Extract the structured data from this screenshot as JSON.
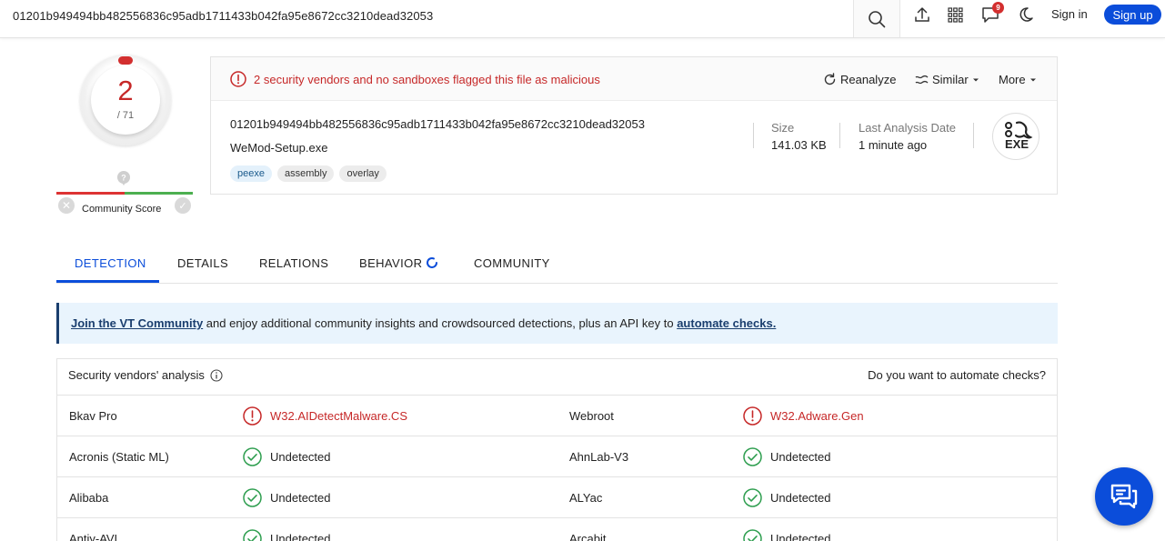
{
  "header": {
    "search_value": "01201b949494bb482556836c95adb1711433b042fa95e8672cc3210dead32053",
    "notification_count": "9",
    "signin_label": "Sign in",
    "signup_label": "Sign up",
    "accent_color": "#0b4dda"
  },
  "score": {
    "detections": "2",
    "total": "/ 71",
    "community_label": "Community Score",
    "community_q": "?"
  },
  "file": {
    "alert_text": "2 security vendors and no sandboxes flagged this file as malicious",
    "reanalyze_label": "Reanalyze",
    "similar_label": "Similar",
    "more_label": "More",
    "hash": "01201b949494bb482556836c95adb1711433b042fa95e8672cc3210dead32053",
    "name": "WeMod-Setup.exe",
    "tags": [
      "peexe",
      "assembly",
      "overlay"
    ],
    "size_label": "Size",
    "size_value": "141.03 KB",
    "date_label": "Last Analysis Date",
    "date_value": "1 minute ago",
    "type_label": "EXE"
  },
  "tabs": [
    "DETECTION",
    "DETAILS",
    "RELATIONS",
    "BEHAVIOR",
    "COMMUNITY"
  ],
  "banner": {
    "link1": "Join the VT Community",
    "middle": " and enjoy additional community insights and crowdsourced detections, plus an API key to ",
    "link2": "automate checks."
  },
  "vendors": {
    "title": "Security vendors' analysis",
    "automate_question": "Do you want to automate checks?",
    "rows": [
      {
        "left_name": "Bkav Pro",
        "left_result": "W32.AIDetectMalware.CS",
        "left_status": "malicious",
        "right_name": "Webroot",
        "right_result": "W32.Adware.Gen",
        "right_status": "malicious"
      },
      {
        "left_name": "Acronis (Static ML)",
        "left_result": "Undetected",
        "left_status": "undetected",
        "right_name": "AhnLab-V3",
        "right_result": "Undetected",
        "right_status": "undetected"
      },
      {
        "left_name": "Alibaba",
        "left_result": "Undetected",
        "left_status": "undetected",
        "right_name": "ALYac",
        "right_result": "Undetected",
        "right_status": "undetected"
      },
      {
        "left_name": "Antiy-AVL",
        "left_result": "Undetected",
        "left_status": "undetected",
        "right_name": "Arcabit",
        "right_result": "Undetected",
        "right_status": "undetected"
      }
    ]
  }
}
